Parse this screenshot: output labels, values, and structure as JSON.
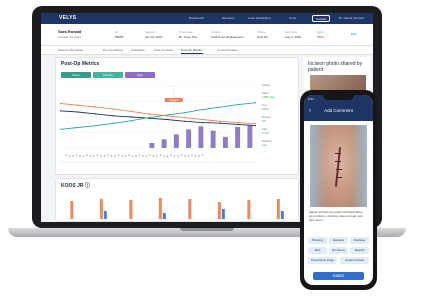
{
  "app": {
    "logo": "VELYS",
    "nav": [
      "Dashboard",
      "Episodes",
      "Case Scheduling",
      "Tools"
    ],
    "nav_button": "Contact",
    "user_menu": "Dr. Daniel Johnson"
  },
  "patient": {
    "name": "Sara Ronald",
    "sub": "Female, 64 years",
    "fields": [
      {
        "key": "ID",
        "value": "55555"
      },
      {
        "key": "Surgery",
        "value": "Jan 30, 2022"
      },
      {
        "key": "Procedure",
        "value": "Rt. Knee TKA"
      },
      {
        "key": "Implant",
        "value": "Total Knee Replacement"
      },
      {
        "key": "Phase",
        "value": "Post Op"
      },
      {
        "key": "Last Visit",
        "value": "Aug 3, 2022"
      },
      {
        "key": "Alerts",
        "value": "PEM"
      }
    ],
    "edit_label": "Edit"
  },
  "tabs": [
    "Patient Information",
    "Pre-Op Metrics",
    "Checklists",
    "Care by Notes",
    "Post-Op Metrics",
    "Communication"
  ],
  "active_tab": 4,
  "metrics_card": {
    "title": "Post-Op Metrics",
    "filters": [
      "Steps",
      "Flexion",
      "Pain"
    ],
    "marker_label": "Surgery",
    "side": [
      {
        "label": "Activity",
        "value": ""
      },
      {
        "label": "Steps",
        "value": "2,845 / day"
      },
      {
        "label": "Avg",
        "value": "3,102"
      },
      {
        "label": "Flexion",
        "value": "97°"
      },
      {
        "label": "Pain",
        "value": "3 / 10"
      },
      {
        "label": "Swelling",
        "value": "Low"
      }
    ]
  },
  "koos_card": {
    "title": "KOOS JR ⓘ"
  },
  "photo_card": {
    "title": "Incision photo shared by patient"
  },
  "phone": {
    "time": "9:41",
    "title": "Add Comment",
    "prompt": "Select at least one option that describes your incision. Add any notes to help your care team.",
    "chips": [
      "Bruising",
      "Redness",
      "Drainage",
      "Pain",
      "No Issues",
      "Warmth",
      "Prescription drugs",
      "Incision Closed"
    ],
    "submit": "SUBMIT"
  },
  "colors": {
    "nav": "#1e3566",
    "series_steps": "#1e3566",
    "series_flexion": "#2aa5a0",
    "series_pain": "#e3855f",
    "bars_steps": "#8f7cc7",
    "bars_koos_orange": "#e98b62",
    "bars_koos_blue": "#4d7fd1",
    "pill_steps": "#3a9a86",
    "pill_flexion": "#46b39a",
    "pill_pain": "#8a6cc4"
  },
  "chart_data": [
    {
      "type": "line",
      "series": [
        {
          "name": "Steps",
          "values": [
            60,
            58,
            55,
            52,
            50,
            48,
            46,
            43,
            41,
            40,
            38,
            36
          ]
        },
        {
          "name": "Flexion",
          "values": [
            30,
            33,
            36,
            40,
            44,
            49,
            53,
            57,
            62,
            66,
            70,
            73
          ]
        },
        {
          "name": "Pain",
          "values": [
            72,
            69,
            66,
            63,
            59,
            55,
            52,
            49,
            46,
            43,
            41,
            39
          ]
        }
      ],
      "bars": [
        0,
        0,
        0,
        0,
        0,
        0,
        0,
        8,
        14,
        22,
        30,
        35,
        28,
        18,
        34,
        36
      ]
    },
    {
      "type": "bar",
      "series": [
        {
          "name": "",
          "values": [
            18,
            20,
            19,
            21,
            20,
            17,
            19,
            20
          ]
        },
        {
          "name": "",
          "values": [
            0,
            8,
            0,
            6,
            0,
            10,
            0,
            8
          ]
        }
      ]
    }
  ]
}
